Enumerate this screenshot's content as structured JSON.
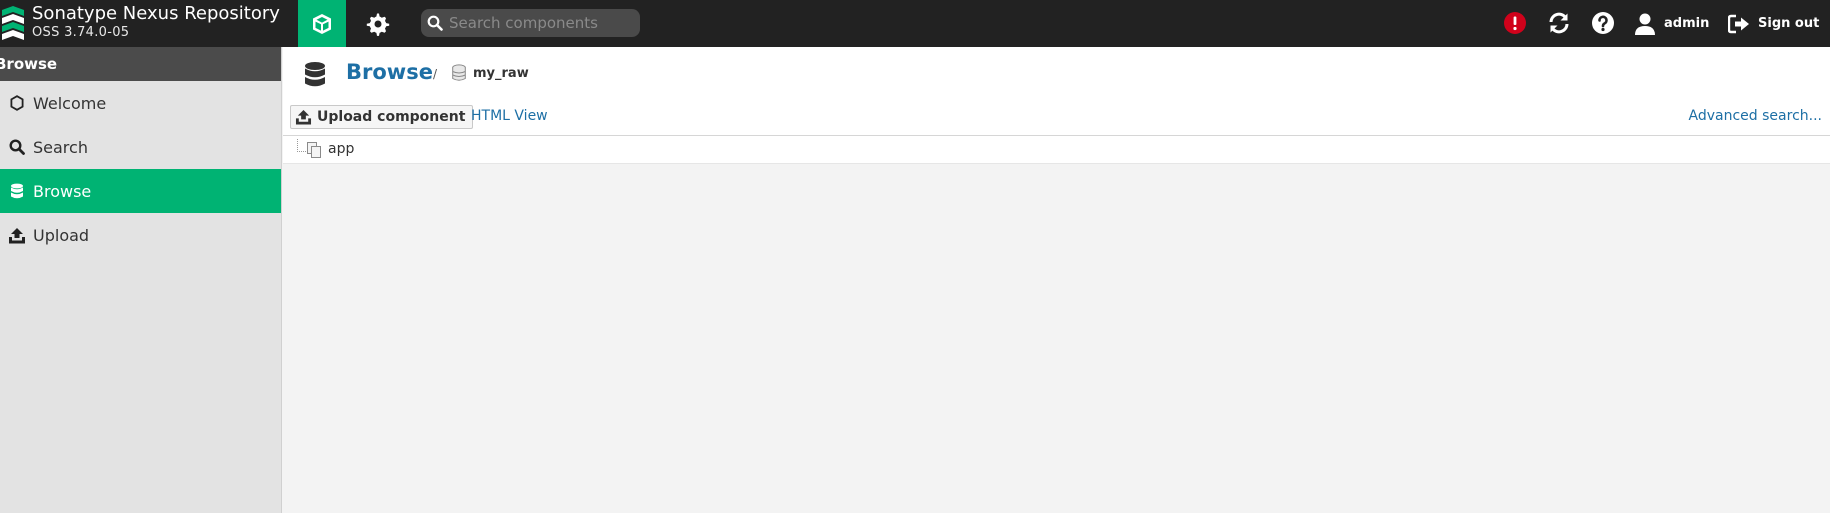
{
  "brand": {
    "title": "Sonatype Nexus Repository",
    "version": "OSS 3.74.0-05"
  },
  "topbar": {
    "search_placeholder": "Search components",
    "user_label": "admin",
    "signout_label": "Sign out",
    "icons": [
      "browse-cube-icon",
      "gear-icon",
      "search-icon",
      "alert-icon",
      "refresh-icon",
      "help-icon",
      "user-icon",
      "sign-out-icon"
    ]
  },
  "sidebar": {
    "header": "Browse",
    "items": [
      {
        "label": "Welcome",
        "icon": "hexagon-icon"
      },
      {
        "label": "Search",
        "icon": "search-icon"
      },
      {
        "label": "Browse",
        "icon": "database-icon",
        "active": true
      },
      {
        "label": "Upload",
        "icon": "upload-icon"
      }
    ]
  },
  "main": {
    "breadcrumb": {
      "title": "Browse",
      "separator": "/",
      "repo": "my_raw"
    },
    "toolbar": {
      "upload_label": "Upload component",
      "html_view_label": "HTML View",
      "advanced_search_label": "Advanced search..."
    },
    "tree": [
      {
        "label": "app",
        "icon": "folder-icon"
      }
    ]
  },
  "colors": {
    "topbar": "#222222",
    "accent": "#00b373",
    "link": "#1d6fa5",
    "alert": "#d0021b",
    "sidebar_bg": "#e3e3e3"
  }
}
